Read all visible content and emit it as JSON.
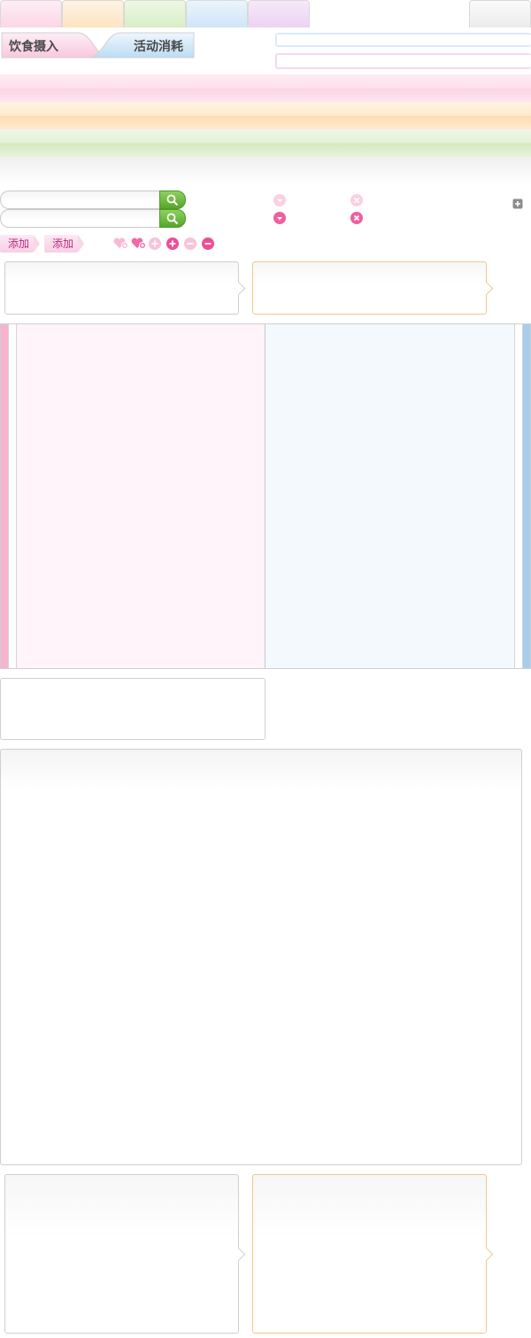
{
  "tabs": {
    "colors": [
      "#fcd6e6",
      "#fde4c2",
      "#d8eec5",
      "#cfe6f8",
      "#ecd2f3",
      "#ececec"
    ]
  },
  "section_tabs": {
    "diet_label": "饮食摄入",
    "activity_label": "活动消耗"
  },
  "search": {
    "input1_value": "",
    "input2_value": ""
  },
  "actions": {
    "add_label_1": "添加",
    "add_label_2": "添加"
  },
  "icons": {
    "expand": "expand-icon",
    "heart_add": "heart-add-icon",
    "plus": "plus-circle-icon",
    "minus": "minus-circle-icon",
    "dropdown": "chevron-down-icon",
    "close": "close-icon"
  },
  "accents": {
    "pink": "#f8b4cf",
    "blue": "#a6cdee",
    "green": "#55a72a",
    "add_text": "#c0267d"
  }
}
